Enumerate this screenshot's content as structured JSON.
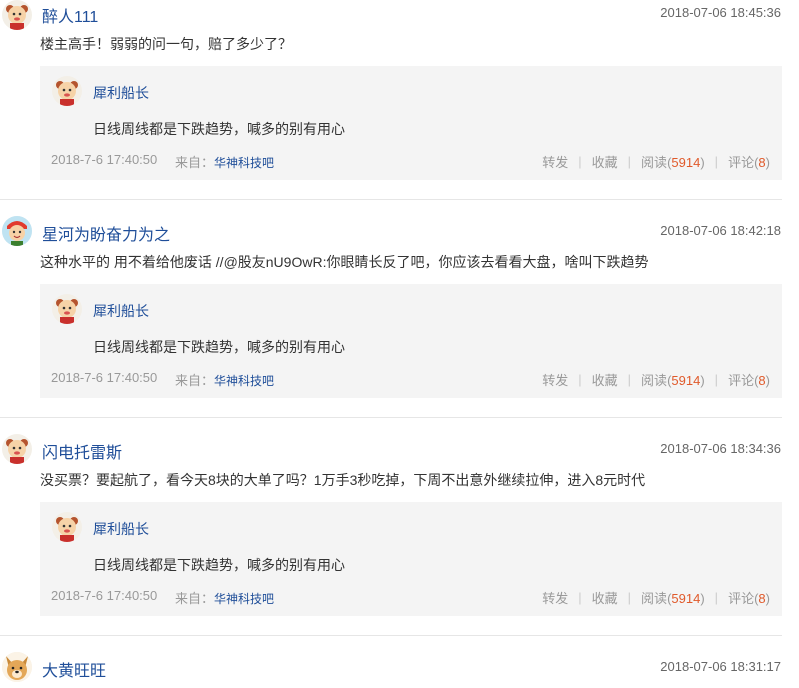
{
  "quote": {
    "author": "犀利船长",
    "text": "日线周线都是下跌趋势，喊多的别有用心",
    "date": "2018-7-6 17:40:50",
    "from_label": "来自：",
    "from_link": "华神科技吧",
    "actions": {
      "repost": "转发",
      "favorite": "收藏",
      "read_label": "阅读",
      "read_count": "5914",
      "comment_label": "评论",
      "comment_count": "8"
    }
  },
  "comments": [
    {
      "username": "醉人111",
      "time": "2018-07-06 18:45:36",
      "text": "楼主高手！弱弱的问一句，赔了多少了？",
      "avatar_icon": "cartoon-avatar-icon"
    },
    {
      "username": "星河为盼奋力为之",
      "time": "2018-07-06 18:42:18",
      "text_prefix": "这种水平的 用不着给他废话 //",
      "mention": "@股友nU9OwR",
      "text_suffix": ":你眼睛长反了吧，你应该去看看大盘，啥叫下跌趋势",
      "avatar_icon": "kid-avatar-icon"
    },
    {
      "username": "闪电托雷斯",
      "time": "2018-07-06 18:34:36",
      "text": "没买票？要起航了，看今天8块的大单了吗？1万手3秒吃掉，下周不出意外继续拉伸，进入8元时代",
      "avatar_icon": "cartoon-avatar-icon"
    },
    {
      "username": "大黄旺旺",
      "time": "2018-07-06 18:31:17",
      "avatar_icon": "dog-avatar-icon"
    }
  ]
}
